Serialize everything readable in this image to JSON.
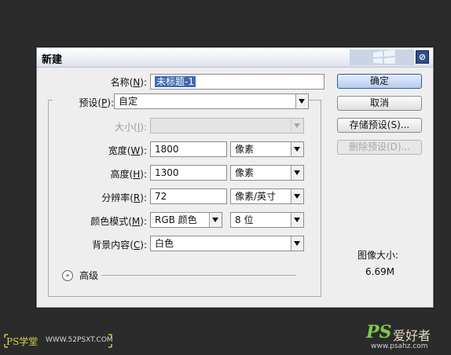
{
  "dialog": {
    "title": "新建",
    "close_icon": "close-icon",
    "fields": {
      "name": {
        "label": "名称",
        "hotkey": "N",
        "value": "未标题-1"
      },
      "preset": {
        "label": "预设",
        "hotkey": "P",
        "value": "自定"
      },
      "size": {
        "label": "大小",
        "hotkey": "I",
        "value": ""
      },
      "width": {
        "label": "宽度",
        "hotkey": "W",
        "value": "1800",
        "unit": "像素"
      },
      "height": {
        "label": "高度",
        "hotkey": "H",
        "value": "1300",
        "unit": "像素"
      },
      "resolution": {
        "label": "分辨率",
        "hotkey": "R",
        "value": "72",
        "unit": "像素/英寸"
      },
      "color_mode": {
        "label": "颜色模式",
        "hotkey": "M",
        "value": "RGB 颜色",
        "depth": "8 位"
      },
      "background": {
        "label": "背景内容",
        "hotkey": "C",
        "value": "白色"
      }
    },
    "advanced_label": "高级",
    "buttons": {
      "ok": "确定",
      "cancel": "取消",
      "save_preset": "存储预设(S)...",
      "delete_preset": "删除预设(D)..."
    },
    "image_size": {
      "label": "图像大小:",
      "value": "6.69M"
    }
  },
  "watermarks": {
    "left_logo": "PS学堂",
    "left_url": "WWW.52PSXT.COM",
    "right_brand": "PS",
    "right_cn": "爱好者",
    "right_url": "www.psahz.com"
  },
  "colors": {
    "background": "#2b2b2b",
    "dialog": "#eeeeee",
    "selection": "#4169b0",
    "primary_button": "#b6cbed"
  }
}
